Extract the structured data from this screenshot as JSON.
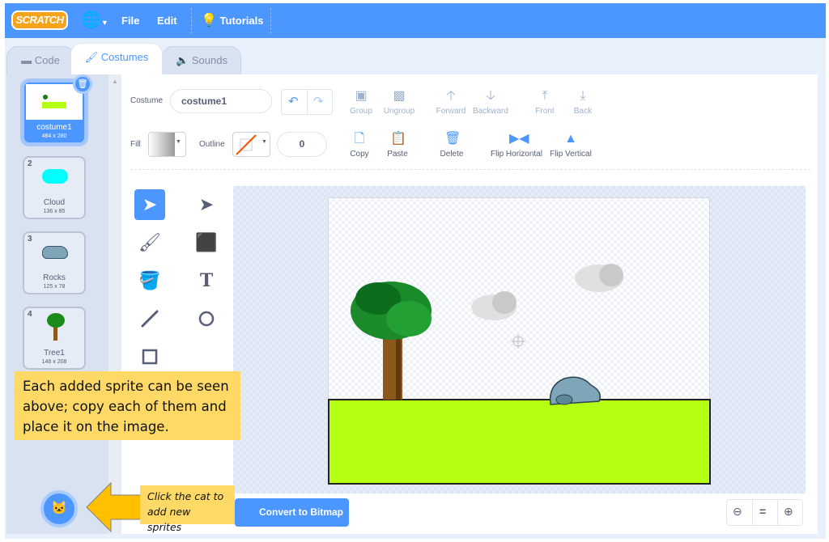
{
  "menubar": {
    "logo": "SCRATCH",
    "file": "File",
    "edit": "Edit",
    "tutorials": "Tutorials",
    "icons": [
      "globe-icon",
      "lightbulb-icon"
    ]
  },
  "tabs": [
    {
      "label": "Code",
      "icon": "code-blocks-icon"
    },
    {
      "label": "Costumes",
      "icon": "brush-icon",
      "active": true
    },
    {
      "label": "Sounds",
      "icon": "speaker-icon"
    }
  ],
  "costumes": [
    {
      "num": "1",
      "name": "costume1",
      "size": "484 x 280",
      "selected": true
    },
    {
      "num": "2",
      "name": "Cloud",
      "size": "136 x 85"
    },
    {
      "num": "3",
      "name": "Rocks",
      "size": "125 x 78"
    },
    {
      "num": "4",
      "name": "Tree1",
      "size": "148 x 208"
    }
  ],
  "toolbar": {
    "costume_label": "Costume",
    "costume_name": "costume1",
    "fill_label": "Fill",
    "outline_label": "Outline",
    "outline_width": "0",
    "group": "Group",
    "ungroup": "Ungroup",
    "forward": "Forward",
    "backward": "Backward",
    "front": "Front",
    "back": "Back",
    "copy": "Copy",
    "paste": "Paste",
    "delete": "Delete",
    "flip_h": "Flip Horizontal",
    "flip_v": "Flip Vertical"
  },
  "convert_button": "Convert to Bitmap",
  "callouts": {
    "main": "Each added sprite can be seen above; copy each of them and place it on the image.",
    "cat": "Click the cat to add new sprites"
  },
  "colors": {
    "accent": "#4c97ff",
    "ground": "#b4ff12",
    "callout": "#ffd966",
    "arrow": "#ffc000"
  }
}
